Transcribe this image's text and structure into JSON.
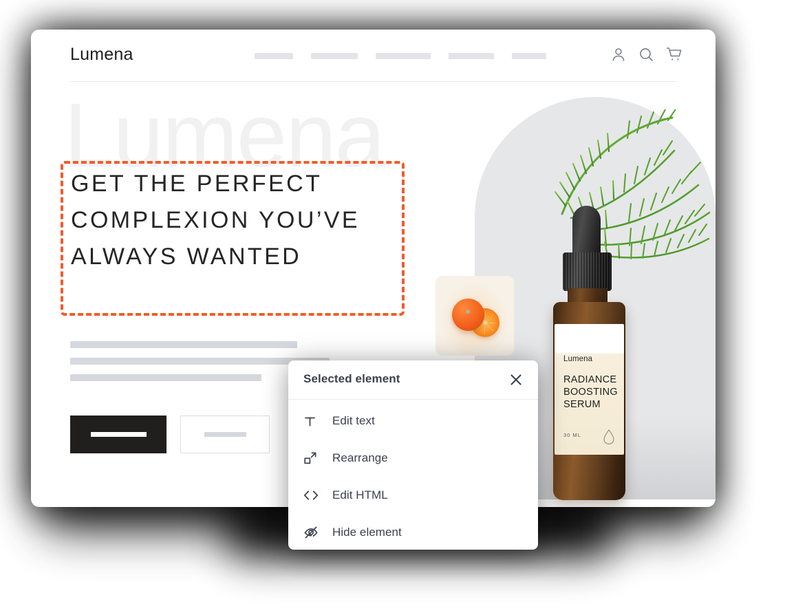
{
  "site": {
    "logo": "Lumena",
    "watermark": "Lumena",
    "nav_placeholder_widths": [
      56,
      68,
      80,
      66,
      50
    ],
    "header_icons": [
      {
        "name": "account-icon",
        "label": "Account"
      },
      {
        "name": "search-icon",
        "label": "Search"
      },
      {
        "name": "cart-icon",
        "label": "Cart"
      }
    ]
  },
  "hero": {
    "headline": "Get the perfect complexion you’ve always wanted",
    "body_line_widths": [
      330,
      377,
      278
    ],
    "buttons": [
      {
        "name": "primary-cta",
        "style": "filled"
      },
      {
        "name": "secondary-cta",
        "style": "outline"
      }
    ]
  },
  "product": {
    "brand": "Lumena",
    "title": "Radiance Boosting Serum",
    "volume": "30 ML"
  },
  "popup": {
    "title": "Selected element",
    "close_label": "✕",
    "items": [
      {
        "icon": "text-icon",
        "label": "Edit text"
      },
      {
        "icon": "rearrange-icon",
        "label": "Rearrange"
      },
      {
        "icon": "code-icon",
        "label": "Edit HTML"
      },
      {
        "icon": "eye-off-icon",
        "label": "Hide element"
      }
    ]
  },
  "colors": {
    "selection_outline": "#ef5c2b",
    "popup_text": "#3c4250",
    "hero_panel": "#e6e7e9",
    "primary_button": "#211f1e"
  }
}
